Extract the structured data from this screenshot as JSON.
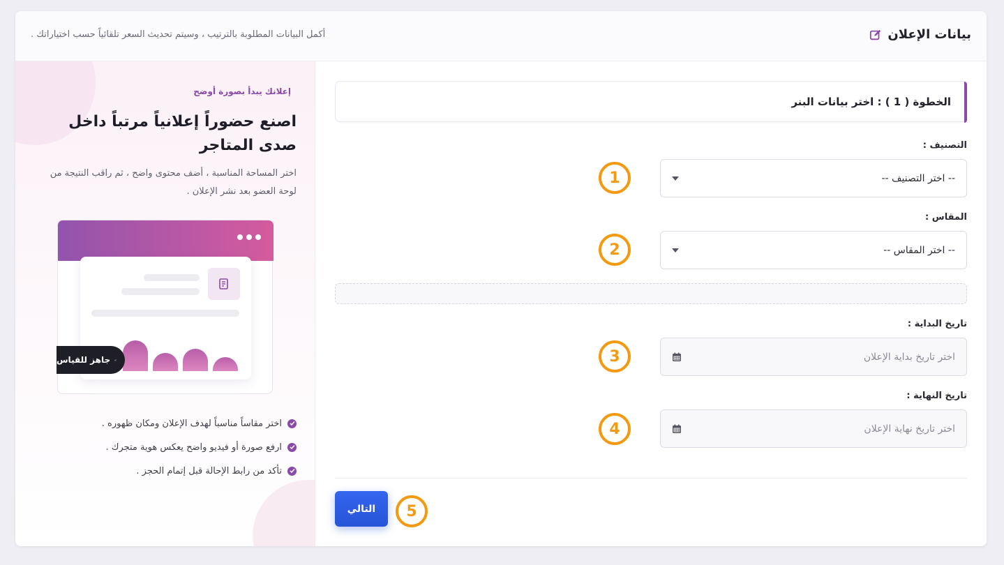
{
  "header": {
    "title": "بيانات الإعلان",
    "subtitle": "أكمل البيانات المطلوبة بالترتيب ، وسيتم تحديث السعر تلقائياً حسب اختياراتك ."
  },
  "promo": {
    "tag": "إعلانك يبدأ بصورة أوضح",
    "title": "اصنع حضوراً إعلانياً مرتباً داخل صدى المتاجر",
    "description": "اختر المساحة المناسبة ، أضف محتوى واضح ، ثم راقب النتيجة من لوحة العضو بعد نشر الإعلان .",
    "pill_label": "جاهز للقياس",
    "checklist": [
      "اختر مقاساً مناسباً لهدف الإعلان ومكان ظهوره .",
      "ارفع صورة أو فيديو واضح يعكس هوية متجرك .",
      "تأكد من رابط الإحالة قبل إتمام الحجز ."
    ]
  },
  "form": {
    "step_title": "الخطوة ( 1 ) : اختر بيانات البنر",
    "category": {
      "label": "التصنيف :",
      "value": "-- اختر التصنيف --"
    },
    "size": {
      "label": "المقاس :",
      "value": "-- اختر المقاس --"
    },
    "start_date": {
      "label": "تاريخ البداية :",
      "placeholder": "اختر تاريخ بداية الإعلان"
    },
    "end_date": {
      "label": "تاريخ النهاية :",
      "placeholder": "اختر تاريخ نهاية الإعلان"
    },
    "next_label": "التالي"
  },
  "annotations": [
    "1",
    "2",
    "3",
    "4",
    "5"
  ],
  "colors": {
    "accent_purple": "#8a4aa8",
    "annotation_orange": "#f39a12",
    "primary_blue": "#2654d8"
  },
  "icons": [
    "edit-icon",
    "menu-dots-icon",
    "document-icon",
    "chart-line-icon",
    "check-circle-icon",
    "caret-down-icon",
    "calendar-icon"
  ]
}
